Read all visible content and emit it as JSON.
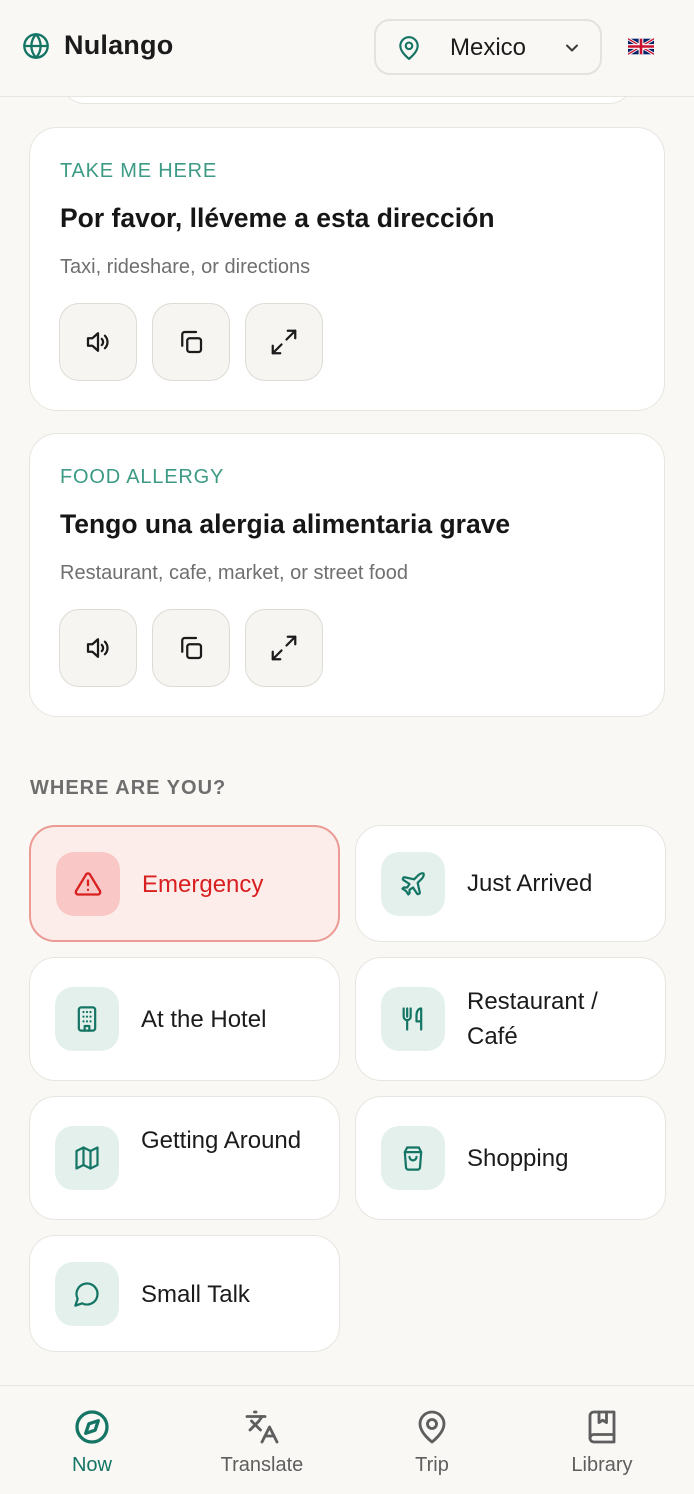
{
  "header": {
    "brand": "Nulango",
    "country": "Mexico",
    "flag": "🇬🇧",
    "icons": {
      "brand": "globe-icon",
      "country": "map-pin-icon",
      "dropdown": "chevron-down-icon"
    }
  },
  "phrase_cards": [
    {
      "kicker": "TAKE ME HERE",
      "phrase": "Por favor, lléveme a esta dirección",
      "hint": "Taxi, rideshare, or directions",
      "actions": [
        "speaker-icon",
        "copy-icon",
        "expand-icon"
      ]
    },
    {
      "kicker": "FOOD ALLERGY",
      "phrase": "Tengo una alergia alimentaria grave",
      "hint": "Restaurant, cafe, market, or street food",
      "actions": [
        "speaker-icon",
        "copy-icon",
        "expand-icon"
      ]
    }
  ],
  "situations": {
    "title": "WHERE ARE YOU?",
    "items": [
      {
        "label": "Emergency",
        "icon": "warning-icon",
        "style": "danger"
      },
      {
        "label": "Just Arrived",
        "icon": "plane-icon"
      },
      {
        "label": "At the Hotel",
        "icon": "building-icon"
      },
      {
        "label": "Restaurant / Café",
        "icon": "utensils-icon"
      },
      {
        "label": "Getting Around",
        "icon": "map-icon"
      },
      {
        "label": "Shopping",
        "icon": "shopping-bag-icon"
      },
      {
        "label": "Small Talk",
        "icon": "chat-bubble-icon"
      }
    ]
  },
  "bottom_nav": {
    "active": "Now",
    "items": [
      {
        "label": "Now",
        "icon": "compass-icon"
      },
      {
        "label": "Translate",
        "icon": "translate-icon"
      },
      {
        "label": "Trip",
        "icon": "map-pin-icon"
      },
      {
        "label": "Library",
        "icon": "book-icon"
      }
    ]
  },
  "colors": {
    "accent": "#157565",
    "kicker": "#3c9a85",
    "danger": "#d92020",
    "danger_bg": "#fcecea",
    "icon_tile_bg": "#e4f0ec",
    "page_bg": "#f9f8f5"
  }
}
